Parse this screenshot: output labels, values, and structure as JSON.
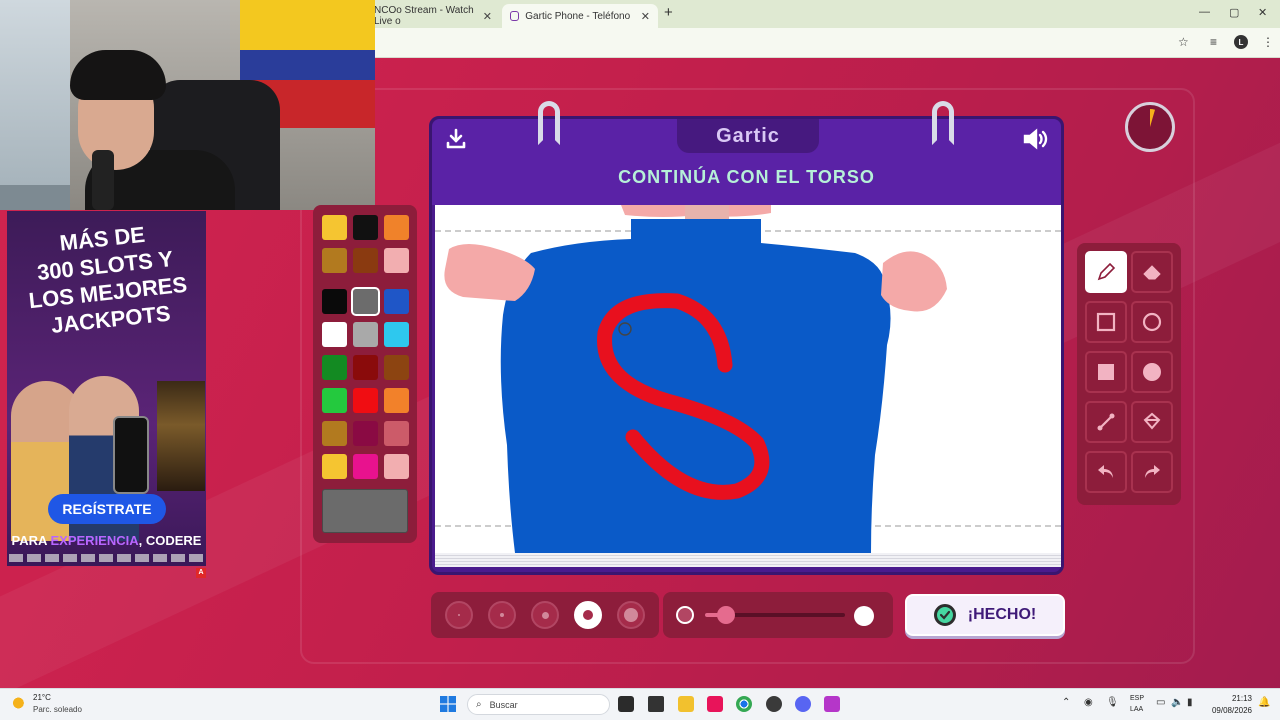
{
  "browser": {
    "tabs": [
      {
        "label": "NCOo Stream - Watch Live o"
      },
      {
        "label": "Gartic Phone - Teléfono Descon"
      }
    ],
    "new_tab": "+",
    "close_glyph": "✕",
    "window_controls": [
      "—",
      "▢",
      "✕"
    ],
    "profile_initial": "L"
  },
  "ad": {
    "title_lines": [
      "MÁS DE",
      "300 SLOTS Y",
      "LOS MEJORES",
      "JACKPOTS"
    ],
    "cta": "REGÍSTRATE",
    "tagline_before": "PARA ",
    "tagline_highlight": "EXPERIENCIA",
    "tagline_after": ", CODERE",
    "corner": "A"
  },
  "game": {
    "logo": "Gartic",
    "prompt": "CONTINÚA CON EL TORSO",
    "done_label": "¡HECHO!",
    "opacity_fraction": 0.15,
    "selected_size_index": 3,
    "selected_tool": "pencil"
  },
  "palette": {
    "colors": [
      [
        "#f5c531",
        "#111111",
        "#f0822a"
      ],
      [
        "#b27a1f",
        "#8a3a10",
        "#f2aeb0"
      ],
      [
        "#0a0a0a",
        "#6c6c6c",
        "#1f56c7"
      ],
      [
        "#ffffff",
        "#a9a9a9",
        "#2ec8ee"
      ],
      [
        "#138a22",
        "#8a0b0b",
        "#8c4411"
      ],
      [
        "#24c93e",
        "#f00d12",
        "#f2812a"
      ],
      [
        "#b27a1f",
        "#8a0a43",
        "#cc5b69"
      ],
      [
        "#f5c531",
        "#e8128e",
        "#f2aeb0"
      ]
    ],
    "selected": [
      2,
      1
    ],
    "current_color": "#6b6b6b"
  },
  "tools": [
    {
      "name": "pencil-tool",
      "icon": "pencil-icon"
    },
    {
      "name": "eraser-tool",
      "icon": "eraser-icon"
    },
    {
      "name": "rectangle-outline-tool",
      "icon": "square-outline-icon"
    },
    {
      "name": "ellipse-outline-tool",
      "icon": "circle-outline-icon"
    },
    {
      "name": "rectangle-fill-tool",
      "icon": "square-filled-icon"
    },
    {
      "name": "ellipse-fill-tool",
      "icon": "circle-filled-icon"
    },
    {
      "name": "line-tool",
      "icon": "line-icon"
    },
    {
      "name": "fill-bucket-tool",
      "icon": "bucket-icon"
    },
    {
      "name": "undo-tool",
      "icon": "undo-icon"
    },
    {
      "name": "redo-tool",
      "icon": "redo-icon"
    }
  ],
  "colors": {
    "torso": "#0a5ac8",
    "skin": "#f4a9a8",
    "letter": "#e8101e",
    "board": "#4a1b8d",
    "accent_text": "#b6f0d8"
  },
  "taskbar": {
    "weather_temp": "21°C",
    "weather_desc": "Parc. soleado",
    "search_placeholder": "Buscar",
    "lang_line1": "ESP",
    "lang_line2": "LAA",
    "time": "21:13",
    "date": "09/08/2026"
  }
}
